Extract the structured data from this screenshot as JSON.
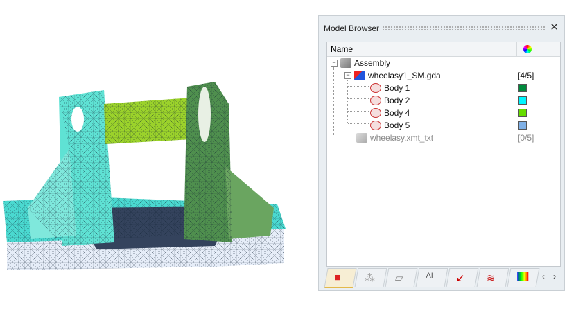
{
  "panel": {
    "title": "Model Browser",
    "close": "✕",
    "column_name": "Name"
  },
  "tree": [
    {
      "label": "Assembly",
      "value": ""
    },
    {
      "label": "wheelasy1_SM.gda",
      "value": "[4/5]"
    },
    {
      "label": "Body 1",
      "color": "#008a3c"
    },
    {
      "label": "Body 2",
      "color": "#00f6ff"
    },
    {
      "label": "Body 4",
      "color": "#66dd00"
    },
    {
      "label": "Body 5",
      "color": "#7fb0e6"
    },
    {
      "label": "wheelasy.xmt_txt",
      "value": "[0/5]"
    }
  ],
  "tabs": [
    "parts-icon",
    "assemblies-icon",
    "surfaces-icon",
    "material-icon",
    "loads-icon",
    "thermal-icon",
    "results-icon"
  ],
  "nav": {
    "prev": "‹",
    "next": "›"
  }
}
